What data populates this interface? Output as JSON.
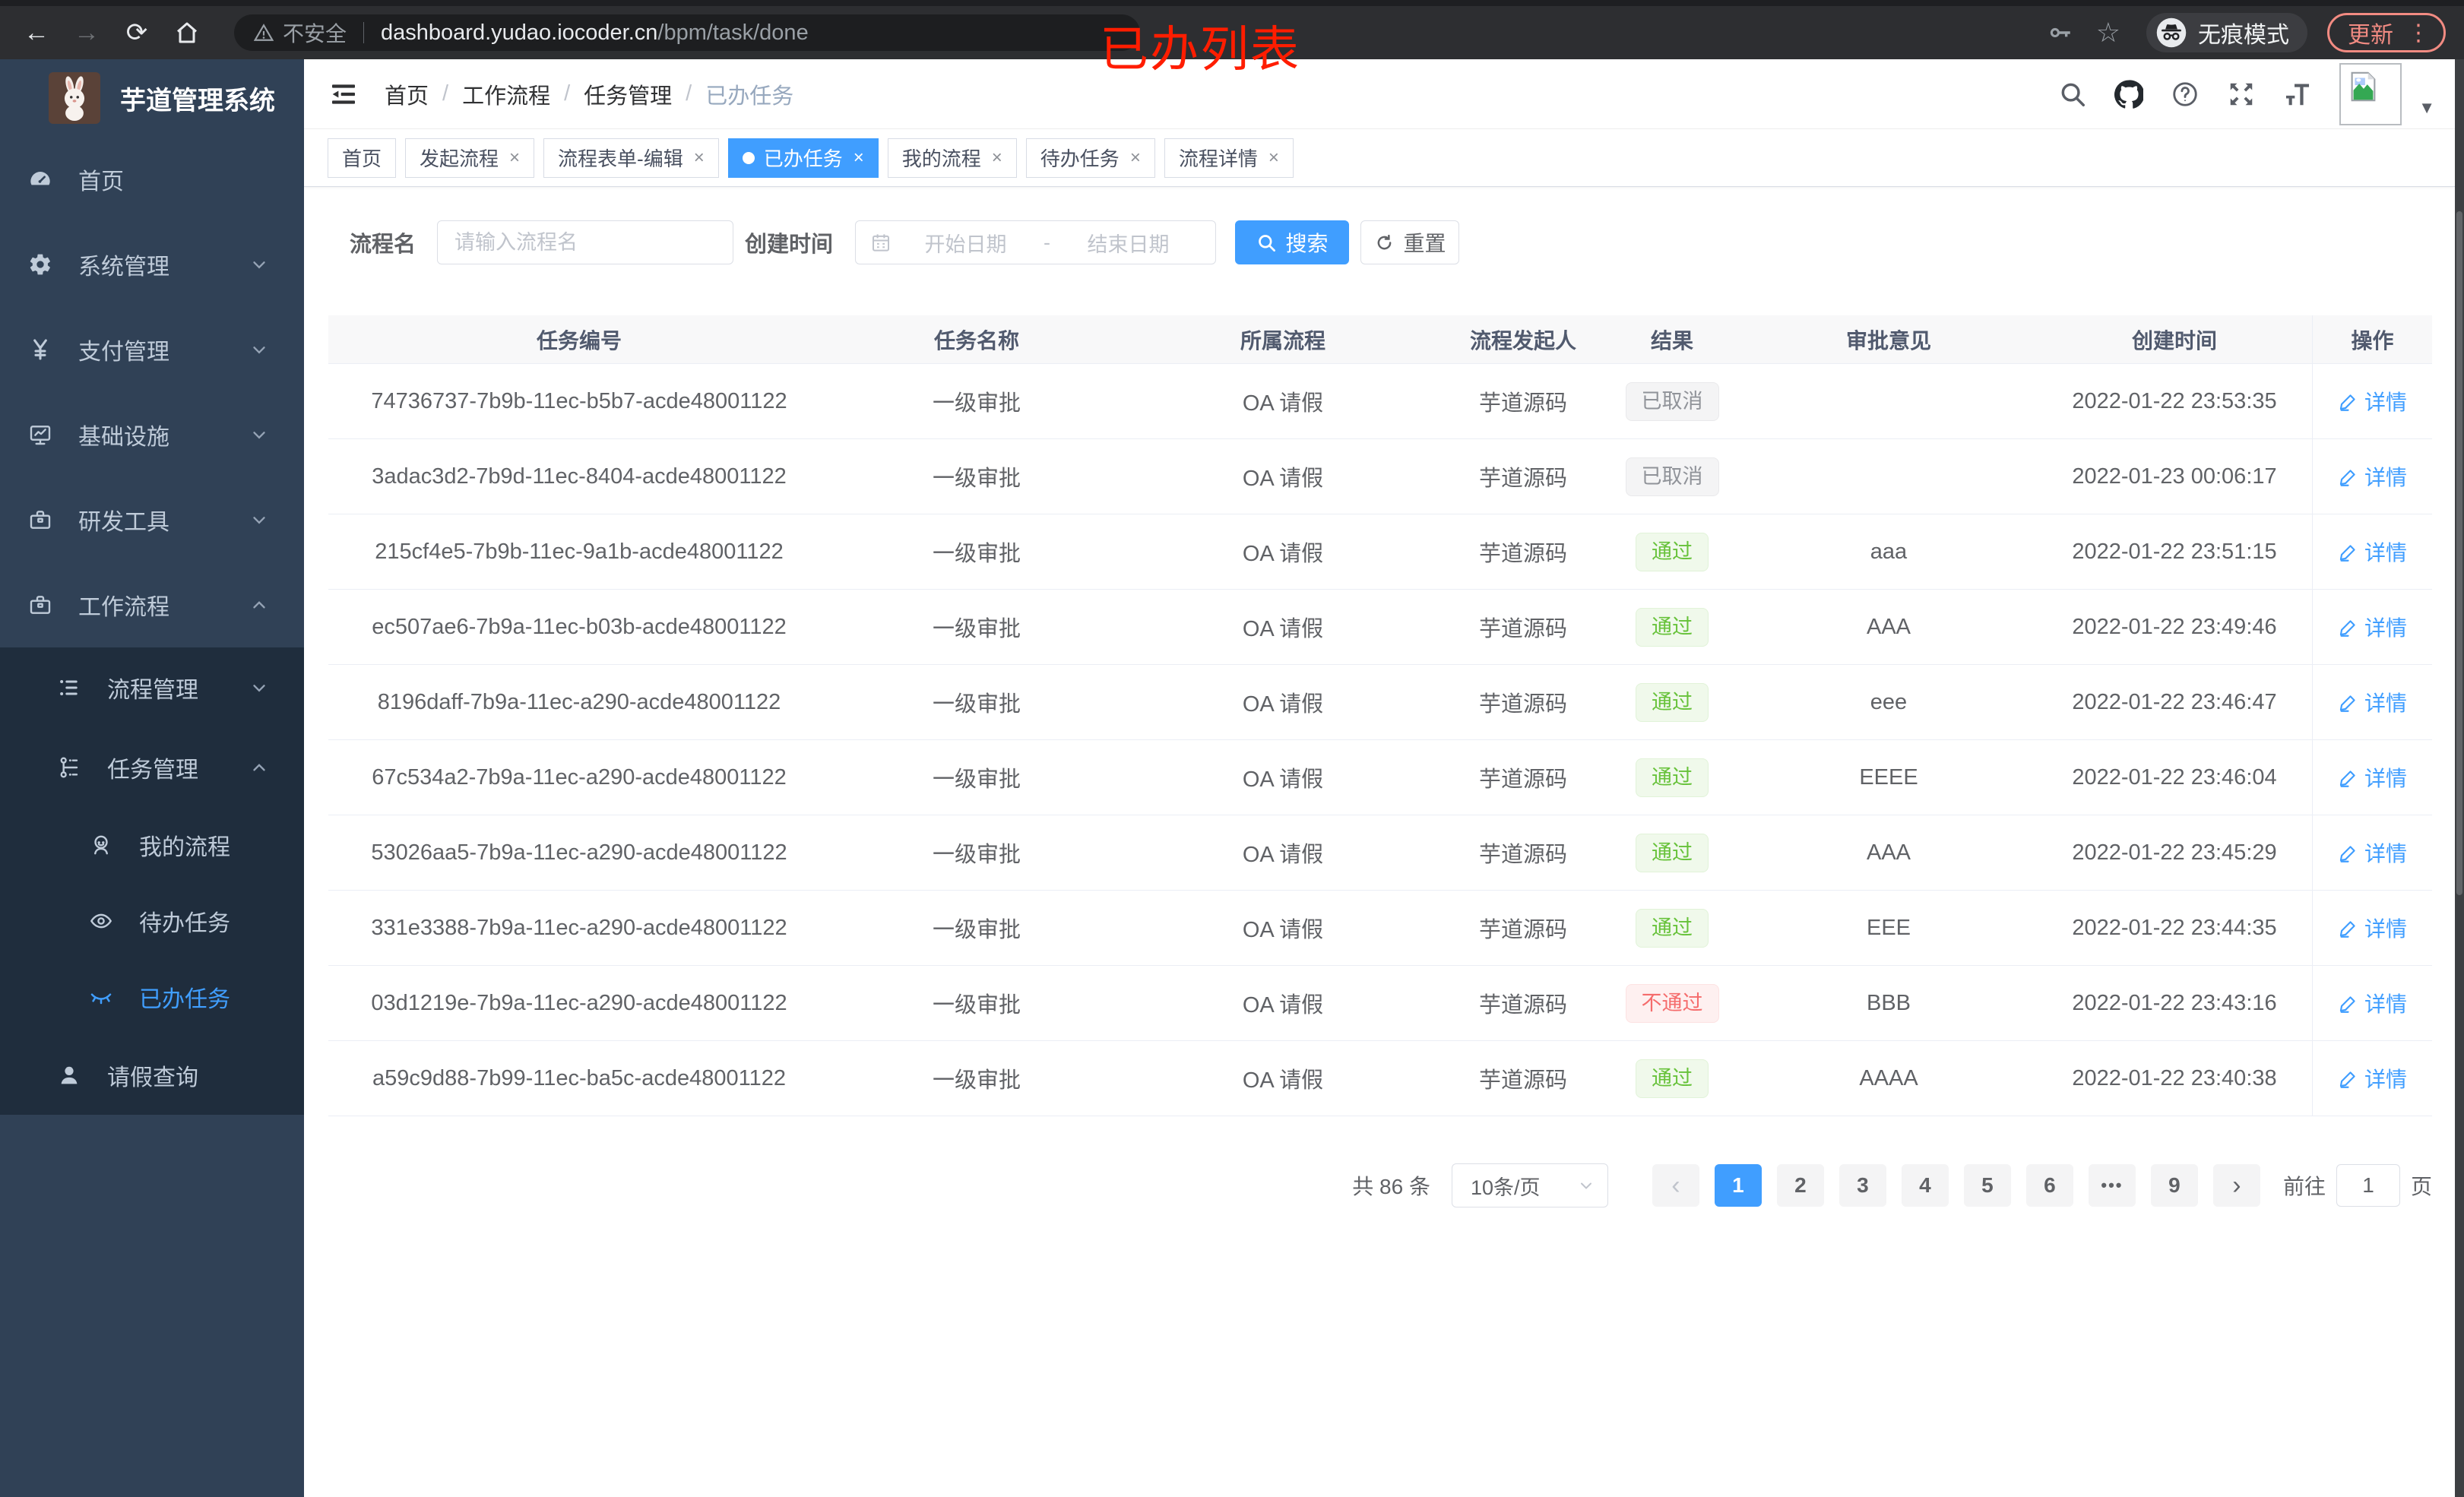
{
  "browser": {
    "security_label": "不安全",
    "url_host": "dashboard.yudao.iocoder.cn",
    "url_path": "/bpm/task/done",
    "incognito_label": "无痕模式",
    "update_label": "更新",
    "menu_dots": "⋮",
    "back": "←",
    "forward": "→",
    "reload": "⟳"
  },
  "annotation": "已办列表",
  "sidebar": {
    "app_title": "芋道管理系统",
    "menu": [
      {
        "key": "home",
        "icon": "dashboard-icon",
        "label": "首页",
        "indent": 0
      },
      {
        "key": "system-mgmt",
        "icon": "gear-icon",
        "label": "系统管理",
        "indent": 0,
        "chevron": "down"
      },
      {
        "key": "payment-mgmt",
        "icon": "yen-icon",
        "label": "支付管理",
        "indent": 0,
        "chevron": "down"
      },
      {
        "key": "infrastructure",
        "icon": "monitor-icon",
        "label": "基础设施",
        "indent": 0,
        "chevron": "down"
      },
      {
        "key": "dev-tools",
        "icon": "toolbox-icon",
        "label": "研发工具",
        "indent": 0,
        "chevron": "down"
      },
      {
        "key": "workflow",
        "icon": "briefcase-icon",
        "label": "工作流程",
        "indent": 0,
        "chevron": "up"
      },
      {
        "key": "process-mgmt",
        "icon": "list-icon",
        "label": "流程管理",
        "indent": 1,
        "chevron": "down",
        "submenu": true
      },
      {
        "key": "task-mgmt",
        "icon": "tree-icon",
        "label": "任务管理",
        "indent": 1,
        "chevron": "up",
        "submenu": true
      },
      {
        "key": "my-process",
        "icon": "face-icon",
        "label": "我的流程",
        "indent": 2,
        "submenu": true
      },
      {
        "key": "todo-tasks",
        "icon": "eye-icon",
        "label": "待办任务",
        "indent": 2,
        "submenu": true
      },
      {
        "key": "done-tasks",
        "icon": "closed-eye-icon",
        "label": "已办任务",
        "indent": 2,
        "submenu": true,
        "active": true
      },
      {
        "key": "leave-query",
        "icon": "user-icon",
        "label": "请假查询",
        "indent": 1,
        "submenu": true
      }
    ]
  },
  "breadcrumb": [
    "首页",
    "工作流程",
    "任务管理",
    "已办任务"
  ],
  "tabs": [
    {
      "key": "home",
      "label": "首页",
      "closable": false,
      "active": false
    },
    {
      "key": "start-process",
      "label": "发起流程",
      "closable": true,
      "active": false
    },
    {
      "key": "form-edit",
      "label": "流程表单-编辑",
      "closable": true,
      "active": false
    },
    {
      "key": "done-tasks",
      "label": "已办任务",
      "closable": true,
      "active": true
    },
    {
      "key": "my-process",
      "label": "我的流程",
      "closable": true,
      "active": false
    },
    {
      "key": "todo-tasks",
      "label": "待办任务",
      "closable": true,
      "active": false
    },
    {
      "key": "process-detail",
      "label": "流程详情",
      "closable": true,
      "active": false
    }
  ],
  "filter": {
    "name_label": "流程名",
    "name_placeholder": "请输入流程名",
    "name_value": "",
    "time_label": "创建时间",
    "start_placeholder": "开始日期",
    "range_separator": "-",
    "end_placeholder": "结束日期",
    "search_label": "搜索",
    "reset_label": "重置"
  },
  "table": {
    "columns": [
      "任务编号",
      "任务名称",
      "所属流程",
      "流程发起人",
      "结果",
      "审批意见",
      "创建时间",
      "操作"
    ],
    "detail_label": "详情",
    "rows": [
      {
        "id": "74736737-7b9b-11ec-b5b7-acde48001122",
        "name": "一级审批",
        "process": "OA 请假",
        "starter": "芋道源码",
        "result": "已取消",
        "result_type": "info",
        "comment": "",
        "time": "2022-01-22 23:53:35"
      },
      {
        "id": "3adac3d2-7b9d-11ec-8404-acde48001122",
        "name": "一级审批",
        "process": "OA 请假",
        "starter": "芋道源码",
        "result": "已取消",
        "result_type": "info",
        "comment": "",
        "time": "2022-01-23 00:06:17"
      },
      {
        "id": "215cf4e5-7b9b-11ec-9a1b-acde48001122",
        "name": "一级审批",
        "process": "OA 请假",
        "starter": "芋道源码",
        "result": "通过",
        "result_type": "success",
        "comment": "aaa",
        "time": "2022-01-22 23:51:15"
      },
      {
        "id": "ec507ae6-7b9a-11ec-b03b-acde48001122",
        "name": "一级审批",
        "process": "OA 请假",
        "starter": "芋道源码",
        "result": "通过",
        "result_type": "success",
        "comment": "AAA",
        "time": "2022-01-22 23:49:46"
      },
      {
        "id": "8196daff-7b9a-11ec-a290-acde48001122",
        "name": "一级审批",
        "process": "OA 请假",
        "starter": "芋道源码",
        "result": "通过",
        "result_type": "success",
        "comment": "eee",
        "time": "2022-01-22 23:46:47"
      },
      {
        "id": "67c534a2-7b9a-11ec-a290-acde48001122",
        "name": "一级审批",
        "process": "OA 请假",
        "starter": "芋道源码",
        "result": "通过",
        "result_type": "success",
        "comment": "EEEE",
        "time": "2022-01-22 23:46:04"
      },
      {
        "id": "53026aa5-7b9a-11ec-a290-acde48001122",
        "name": "一级审批",
        "process": "OA 请假",
        "starter": "芋道源码",
        "result": "通过",
        "result_type": "success",
        "comment": "AAA",
        "time": "2022-01-22 23:45:29"
      },
      {
        "id": "331e3388-7b9a-11ec-a290-acde48001122",
        "name": "一级审批",
        "process": "OA 请假",
        "starter": "芋道源码",
        "result": "通过",
        "result_type": "success",
        "comment": "EEE",
        "time": "2022-01-22 23:44:35"
      },
      {
        "id": "03d1219e-7b9a-11ec-a290-acde48001122",
        "name": "一级审批",
        "process": "OA 请假",
        "starter": "芋道源码",
        "result": "不通过",
        "result_type": "danger",
        "comment": "BBB",
        "time": "2022-01-22 23:43:16"
      },
      {
        "id": "a59c9d88-7b99-11ec-ba5c-acde48001122",
        "name": "一级审批",
        "process": "OA 请假",
        "starter": "芋道源码",
        "result": "通过",
        "result_type": "success",
        "comment": "AAAA",
        "time": "2022-01-22 23:40:38"
      }
    ]
  },
  "pagination": {
    "total_label": "共 86 条",
    "page_size": "10条/页",
    "prev": "‹",
    "next": "›",
    "pages": [
      {
        "label": "1",
        "active": true
      },
      {
        "label": "2",
        "active": false
      },
      {
        "label": "3",
        "active": false
      },
      {
        "label": "4",
        "active": false
      },
      {
        "label": "5",
        "active": false
      },
      {
        "label": "6",
        "active": false
      },
      {
        "label": "•••",
        "active": false,
        "more": true
      },
      {
        "label": "9",
        "active": false
      }
    ],
    "goto_label": "前往",
    "goto_value": "1",
    "page_unit_label": "页"
  },
  "colors": {
    "accent": "#409eff",
    "sidebar_bg": "#304156",
    "submenu_bg": "#1f2d3d",
    "tag_success": "#67c23a",
    "tag_danger": "#f56c6c",
    "tag_info": "#909399",
    "annotation_red": "#ff1d00",
    "chrome_update": "#f28b82"
  }
}
